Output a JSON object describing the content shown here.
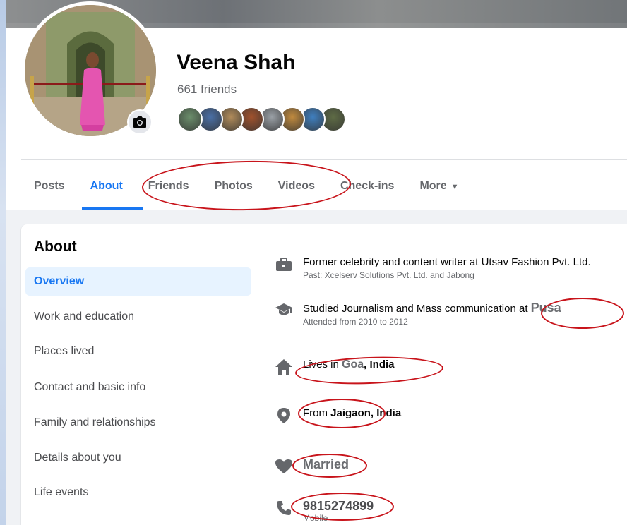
{
  "profile": {
    "name": "Veena Shah",
    "friends_count": "661 friends",
    "friend_avatar_colors": [
      "#6b8e6b",
      "#4a6fa5",
      "#b08b5a",
      "#a0522d",
      "#9aa0a6",
      "#c08a3e",
      "#3f7fbf",
      "#5e6b45"
    ]
  },
  "tabs": [
    {
      "label": "Posts",
      "active": false
    },
    {
      "label": "About",
      "active": true
    },
    {
      "label": "Friends",
      "active": false
    },
    {
      "label": "Photos",
      "active": false
    },
    {
      "label": "Videos",
      "active": false
    },
    {
      "label": "Check-ins",
      "active": false
    },
    {
      "label": "More",
      "active": false
    }
  ],
  "about": {
    "title": "About",
    "sidebar": [
      {
        "label": "Overview",
        "active": true
      },
      {
        "label": "Work and education"
      },
      {
        "label": "Places lived"
      },
      {
        "label": "Contact and basic info"
      },
      {
        "label": "Family and relationships"
      },
      {
        "label": "Details about you"
      },
      {
        "label": "Life events"
      }
    ],
    "overview": {
      "work": {
        "main": "Former celebrity and content writer at Utsav Fashion Pvt. Ltd.",
        "sub": "Past: Xcelserv Solutions Pvt. Ltd. and Jabong"
      },
      "education": {
        "main": "Studied Journalism and Mass communication",
        "at": "at",
        "school": "Pusa",
        "sub": "Attended from 2010 to 2012"
      },
      "lives": {
        "prefix": "Lives in",
        "city": "Goa",
        "country": ", India"
      },
      "from": {
        "prefix": "From",
        "place": "Jaigaon, India"
      },
      "relationship": "Married",
      "phone": {
        "number": "9815274899",
        "type": "Mobile"
      }
    }
  },
  "colors": {
    "accent": "#1877f2",
    "annotation": "#c8141b",
    "text_secondary": "#65676b"
  },
  "icons": {
    "camera": "camera-icon",
    "work": "briefcase-icon",
    "education": "graduation-cap-icon",
    "lives": "home-icon",
    "from": "location-pin-icon",
    "relationship": "heart-icon",
    "phone": "phone-icon",
    "more": "caret-down-icon"
  }
}
